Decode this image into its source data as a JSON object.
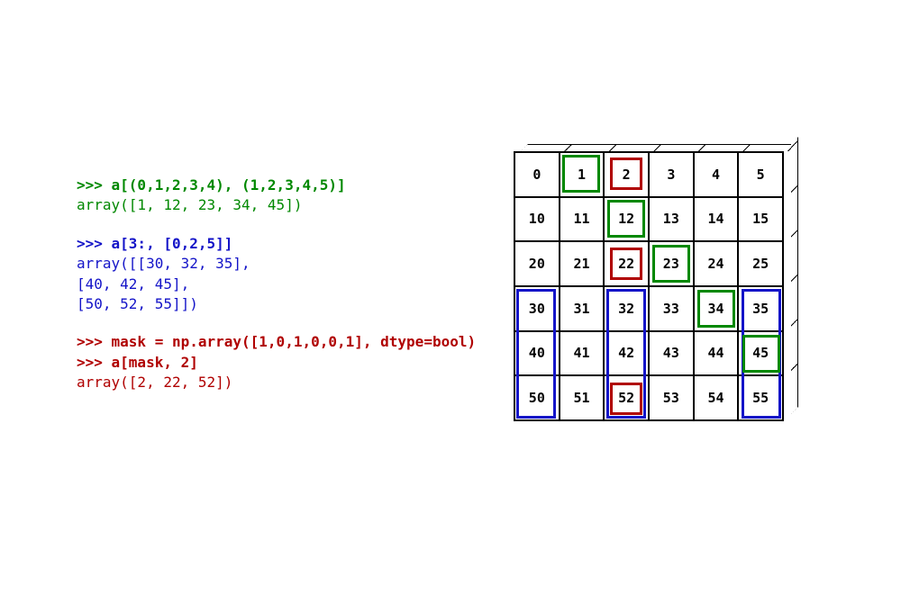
{
  "code": {
    "block1": {
      "prompt": ">>> a[(0,1,2,3,4), (1,2,3,4,5)]",
      "output": "array([1, 12, 23, 34, 45])"
    },
    "block2": {
      "prompt": ">>> a[3:, [0,2,5]]",
      "out1": "array([[30, 32, 35],",
      "out2": "       [40, 42, 45],",
      "out3": "       [50, 52, 55]])"
    },
    "block3": {
      "prompt1": ">>> mask = np.array([1,0,1,0,0,1], dtype=bool)",
      "prompt2": ">>> a[mask, 2]",
      "output": "array([2, 22, 52])"
    }
  },
  "grid": {
    "rows": 6,
    "cols": 6,
    "values": [
      [
        0,
        1,
        2,
        3,
        4,
        5
      ],
      [
        10,
        11,
        12,
        13,
        14,
        15
      ],
      [
        20,
        21,
        22,
        23,
        24,
        25
      ],
      [
        30,
        31,
        32,
        33,
        34,
        35
      ],
      [
        40,
        41,
        42,
        43,
        44,
        45
      ],
      [
        50,
        51,
        52,
        53,
        54,
        55
      ]
    ]
  },
  "highlights": {
    "green_cells": [
      [
        0,
        1
      ],
      [
        1,
        2
      ],
      [
        2,
        3
      ],
      [
        3,
        4
      ],
      [
        4,
        5
      ]
    ],
    "red_cells": [
      [
        0,
        2
      ],
      [
        2,
        2
      ],
      [
        5,
        2
      ]
    ],
    "blue_rects": [
      {
        "r0": 3,
        "c0": 0,
        "r1": 5,
        "c1": 0
      },
      {
        "r0": 3,
        "c0": 2,
        "r1": 5,
        "c1": 2
      },
      {
        "r0": 3,
        "c0": 5,
        "r1": 5,
        "c1": 5
      }
    ]
  },
  "chart_data": {
    "type": "table",
    "description": "6x6 numpy array visualization with fancy-indexing highlights",
    "array": [
      [
        0,
        1,
        2,
        3,
        4,
        5
      ],
      [
        10,
        11,
        12,
        13,
        14,
        15
      ],
      [
        20,
        21,
        22,
        23,
        24,
        25
      ],
      [
        30,
        31,
        32,
        33,
        34,
        35
      ],
      [
        40,
        41,
        42,
        43,
        44,
        45
      ],
      [
        50,
        51,
        52,
        53,
        54,
        55
      ]
    ],
    "highlights": [
      {
        "color": "green",
        "kind": "diagonal-integer-index",
        "cells": [
          [
            0,
            1
          ],
          [
            1,
            2
          ],
          [
            2,
            3
          ],
          [
            3,
            4
          ],
          [
            4,
            5
          ]
        ],
        "result": [
          1,
          12,
          23,
          34,
          45
        ]
      },
      {
        "color": "blue",
        "kind": "slice-cols",
        "rows": [
          3,
          4,
          5
        ],
        "cols": [
          0,
          2,
          5
        ],
        "result": [
          [
            30,
            32,
            35
          ],
          [
            40,
            42,
            45
          ],
          [
            50,
            52,
            55
          ]
        ]
      },
      {
        "color": "red",
        "kind": "boolean-mask",
        "mask": [
          1,
          0,
          1,
          0,
          0,
          1
        ],
        "col": 2,
        "cells": [
          [
            0,
            2
          ],
          [
            2,
            2
          ],
          [
            5,
            2
          ]
        ],
        "result": [
          2,
          22,
          52
        ]
      }
    ]
  }
}
